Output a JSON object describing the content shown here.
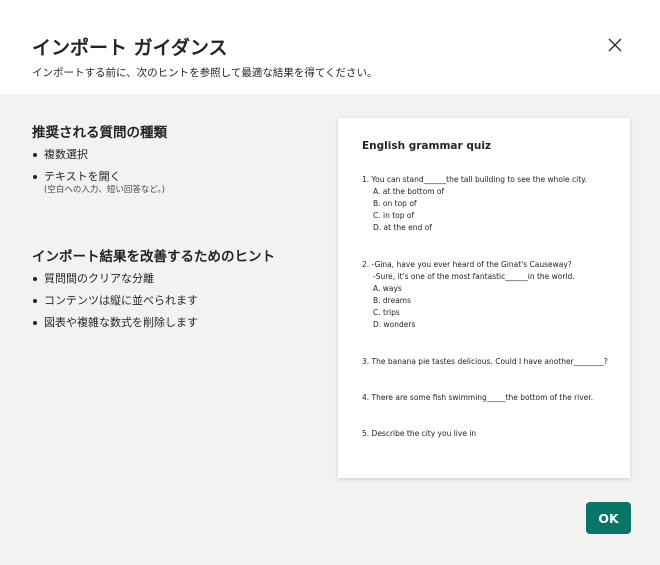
{
  "dialog": {
    "title": "インポート ガイダンス",
    "subtitle": "インポートする前に、次のヒントを参照して最適な結果を得てください。",
    "close_icon": "close-icon"
  },
  "question_types": {
    "heading": "推奨される質問の種類",
    "items": [
      "複数選択",
      "テキストを開く"
    ],
    "note": "(空白への入力、短い回答など。)"
  },
  "hints": {
    "heading": "インポート結果を改善するためのヒント",
    "items": [
      "質問間のクリアな分離",
      "コンテンツは縦に並べられます",
      "図表や複雑な数式を削除します"
    ]
  },
  "preview": {
    "title": "English grammar quiz",
    "questions": [
      {
        "lines": [
          "1.  You can stand______the tall building to see the whole city."
        ],
        "options": [
          "A. at the bottom of",
          "B. on top of",
          "C. in top of",
          "D. at the end of"
        ]
      },
      {
        "lines": [
          "2.  -Gina, have you ever heard of the Ginat's Causeway?",
          "-Sure, it's one of the most fantastic______in the world."
        ],
        "options": [
          "A. ways",
          "B. dreams",
          "C. trips",
          "D. wonders"
        ]
      },
      {
        "lines": [
          "3.  The banana pie tastes delicious. Could I have another________?"
        ],
        "options": []
      },
      {
        "lines": [
          "4.  There are some fish swimming_____the bottom of the river."
        ],
        "options": []
      },
      {
        "lines": [
          "5.  Describe the city you live in"
        ],
        "options": []
      }
    ]
  },
  "footer": {
    "ok_label": "OK",
    "ok_color": "#077568"
  }
}
